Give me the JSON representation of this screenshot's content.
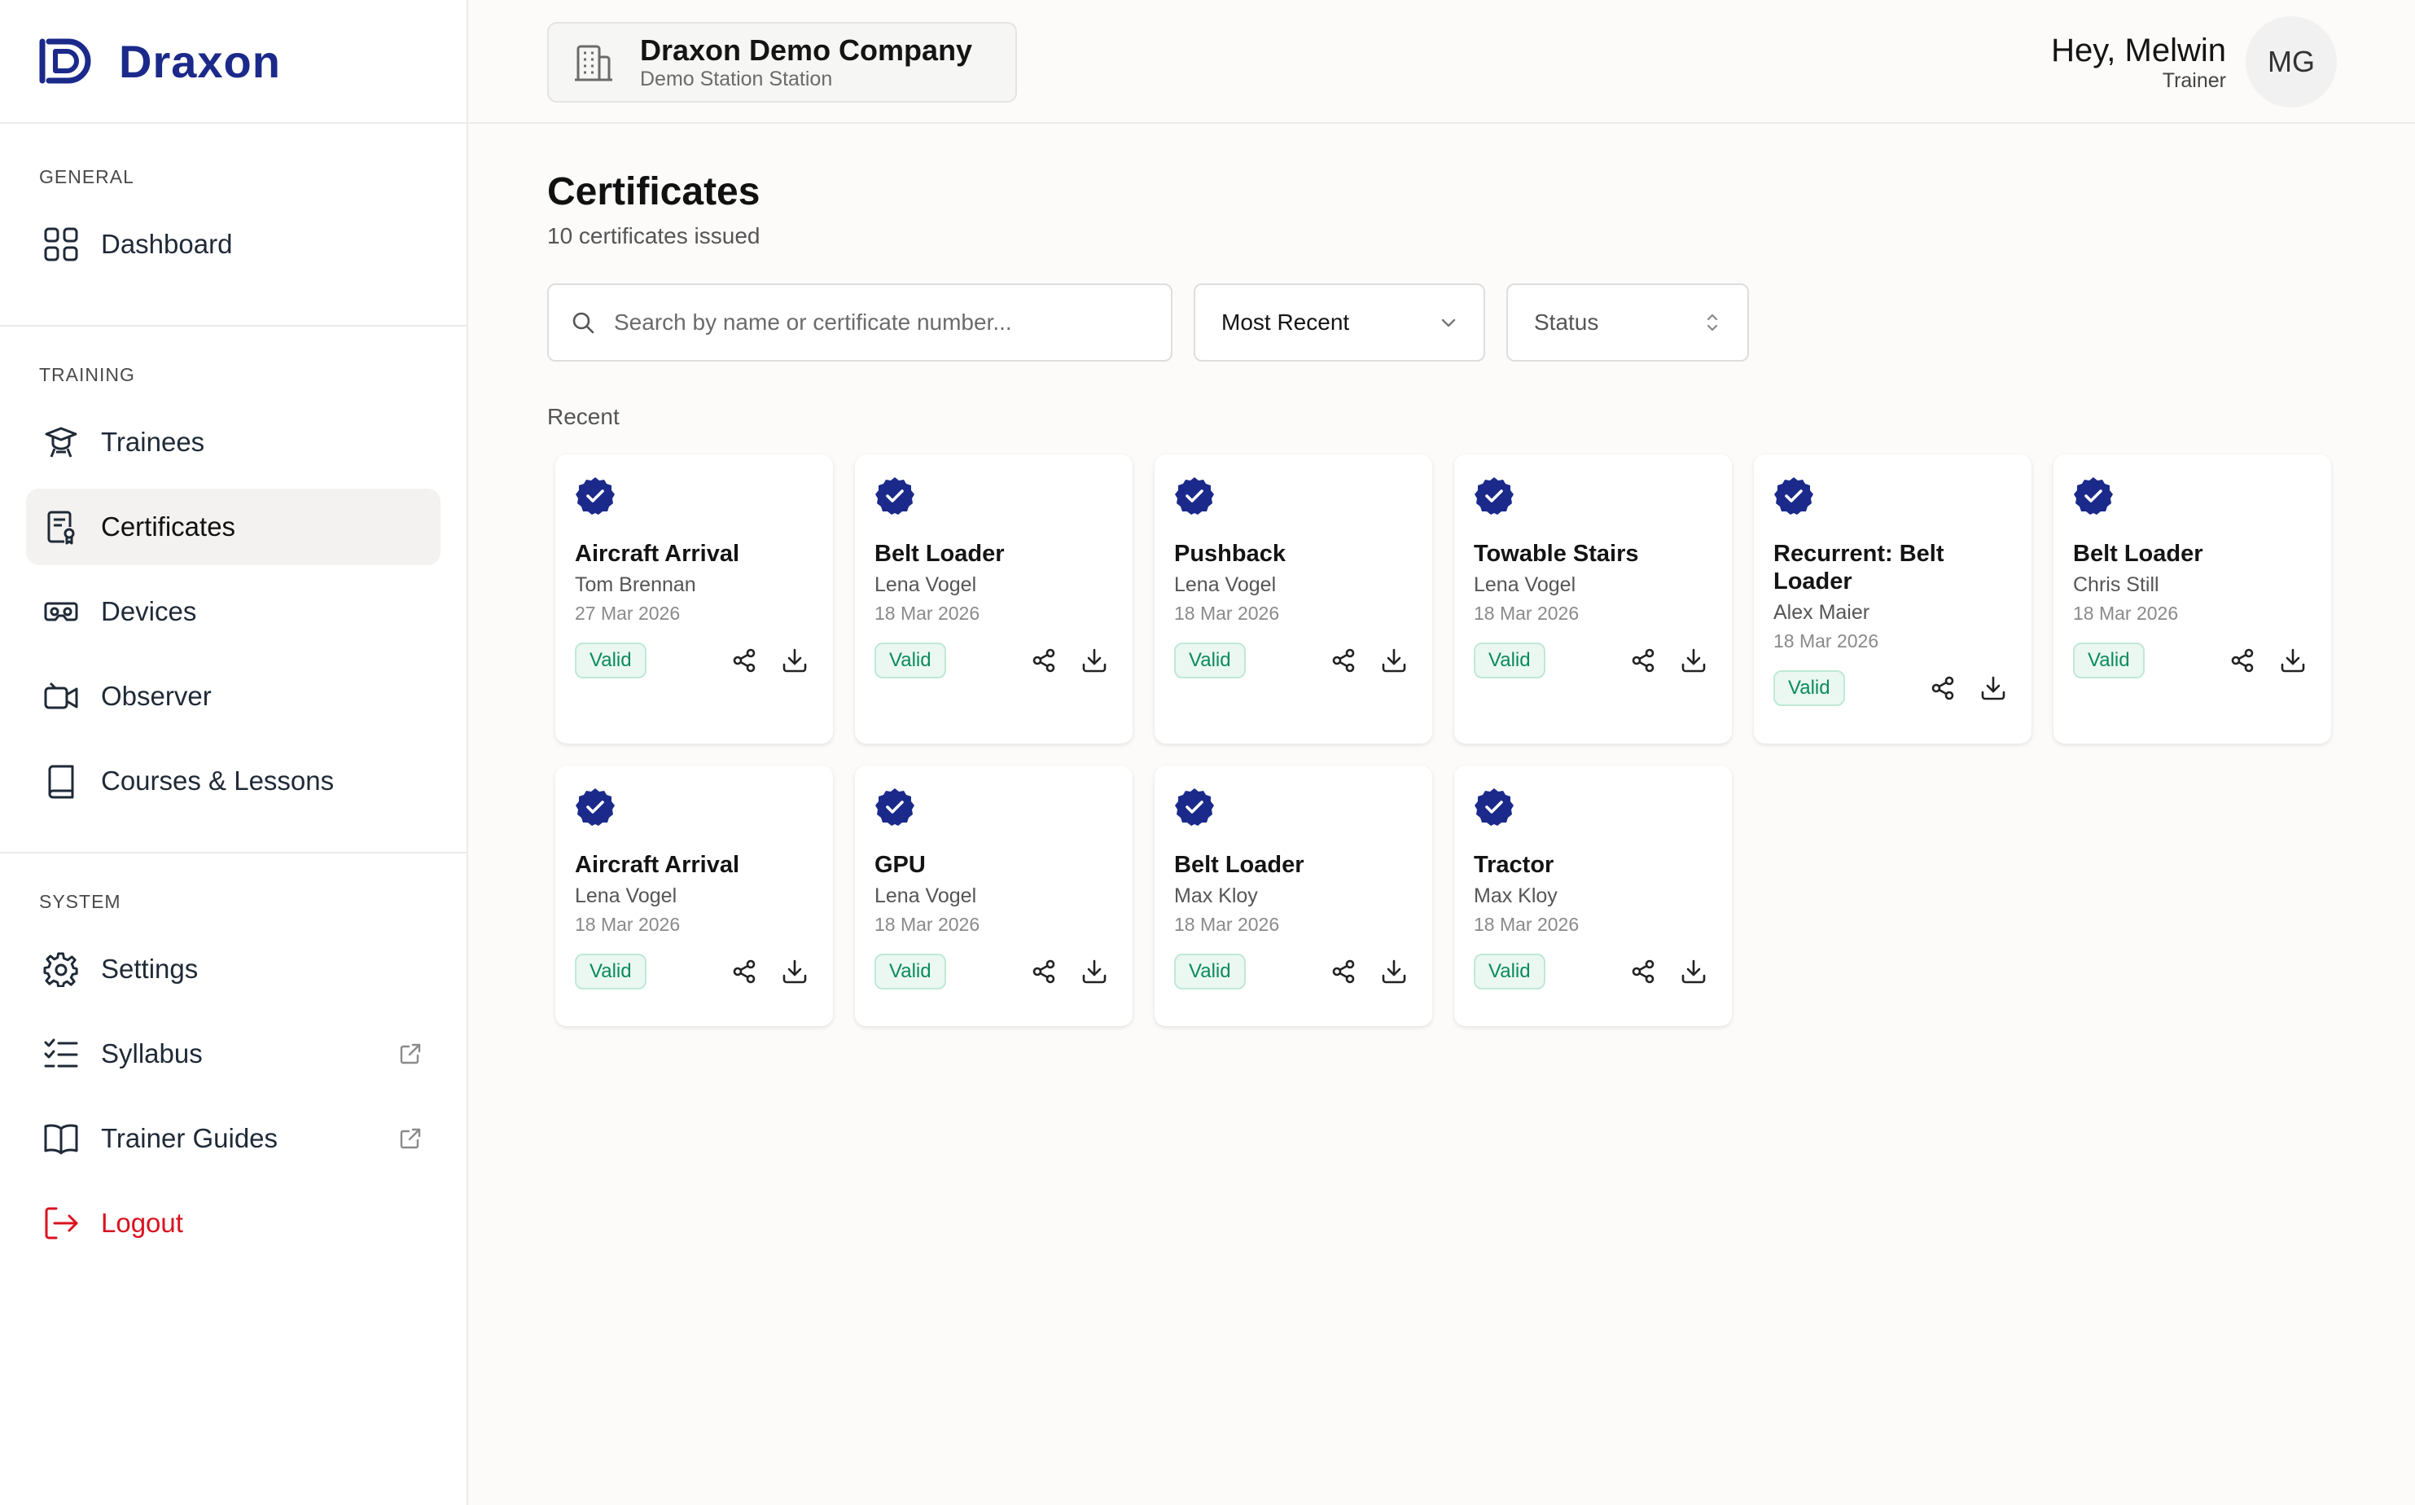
{
  "brand": {
    "name": "Draxon",
    "accent": "#1b2a8a"
  },
  "header": {
    "company_name": "Draxon Demo Company",
    "company_sub": "Demo Station Station",
    "greeting": "Hey, Melwin",
    "role": "Trainer",
    "avatar_initials": "MG"
  },
  "sidebar": {
    "general_title": "GENERAL",
    "training_title": "TRAINING",
    "system_title": "SYSTEM",
    "items": [
      {
        "label": "Dashboard",
        "icon": "grid-icon"
      },
      {
        "label": "Trainees",
        "icon": "graduation-icon"
      },
      {
        "label": "Certificates",
        "icon": "certificate-icon",
        "active": true
      },
      {
        "label": "Devices",
        "icon": "vr-headset-icon"
      },
      {
        "label": "Observer",
        "icon": "video-camera-icon"
      },
      {
        "label": "Courses & Lessons",
        "icon": "book-icon"
      },
      {
        "label": "Settings",
        "icon": "gear-icon"
      },
      {
        "label": "Syllabus",
        "icon": "checklist-icon",
        "external": true
      },
      {
        "label": "Trainer Guides",
        "icon": "open-book-icon",
        "external": true
      },
      {
        "label": "Logout",
        "icon": "logout-icon"
      }
    ]
  },
  "main": {
    "title": "Certificates",
    "subtitle": "10 certificates issued",
    "search_placeholder": "Search by name or certificate number...",
    "sort_value": "Most Recent",
    "status_value": "Status",
    "recent_label": "Recent"
  },
  "certificates": [
    {
      "title": "Aircraft Arrival",
      "name": "Tom Brennan",
      "date": "27 Mar 2026",
      "status": "Valid"
    },
    {
      "title": "Belt Loader",
      "name": "Lena Vogel",
      "date": "18 Mar 2026",
      "status": "Valid"
    },
    {
      "title": "Pushback",
      "name": "Lena Vogel",
      "date": "18 Mar 2026",
      "status": "Valid"
    },
    {
      "title": "Towable Stairs",
      "name": "Lena Vogel",
      "date": "18 Mar 2026",
      "status": "Valid"
    },
    {
      "title": "Recurrent: Belt Loader",
      "name": "Alex Maier",
      "date": "18 Mar 2026",
      "status": "Valid"
    },
    {
      "title": "Belt Loader",
      "name": "Chris Still",
      "date": "18 Mar 2026",
      "status": "Valid"
    },
    {
      "title": "Aircraft Arrival",
      "name": "Lena Vogel",
      "date": "18 Mar 2026",
      "status": "Valid"
    },
    {
      "title": "GPU",
      "name": "Lena Vogel",
      "date": "18 Mar 2026",
      "status": "Valid"
    },
    {
      "title": "Belt Loader",
      "name": "Max Kloy",
      "date": "18 Mar 2026",
      "status": "Valid"
    },
    {
      "title": "Tractor",
      "name": "Max Kloy",
      "date": "18 Mar 2026",
      "status": "Valid"
    }
  ]
}
